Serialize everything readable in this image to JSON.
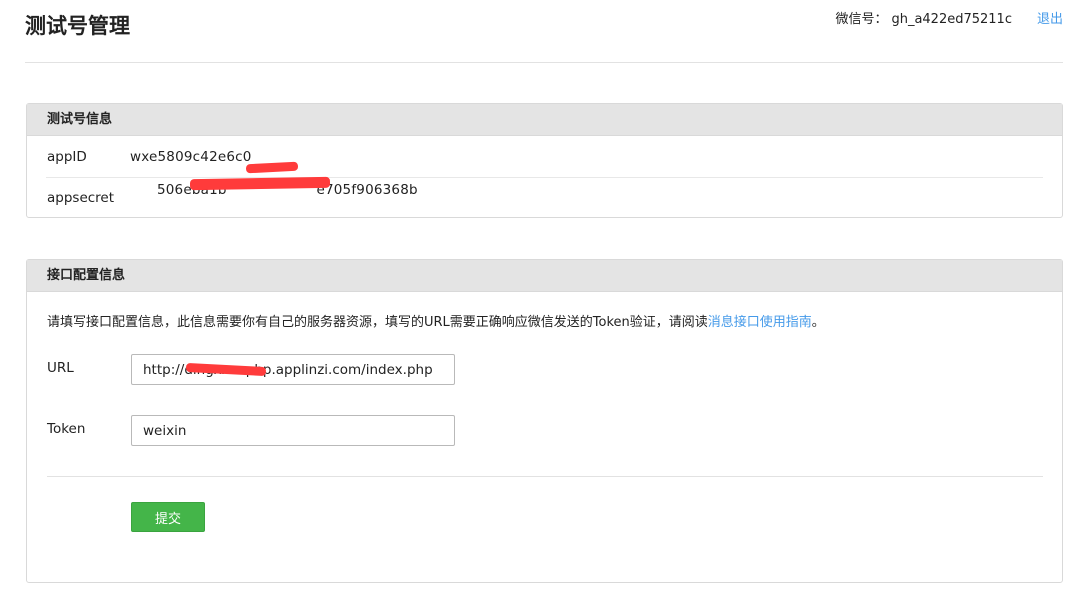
{
  "header": {
    "title": "测试号管理",
    "wechat_id_label": "微信号：",
    "wechat_id": "gh_a422ed75211c",
    "logout_label": "退出"
  },
  "test_account": {
    "heading": "测试号信息",
    "rows": [
      {
        "label": "appID",
        "value": "wxe5809c42e6c0"
      },
      {
        "label": "appsecret",
        "value": "506eba1b                    e705f906368b"
      }
    ]
  },
  "interface_config": {
    "heading": "接口配置信息",
    "description": "请填写接口配置信息，此信息需要你有自己的服务器资源，填写的URL需要正确响应微信发送的Token验证，请阅读",
    "description_link": "消息接口使用指南",
    "description_end": "。",
    "url_label": "URL",
    "url_value": "http://dingxxxxphp.applinzi.com/index.php",
    "token_label": "Token",
    "token_value": "weixin",
    "submit_label": "提交"
  },
  "colors": {
    "accent_link": "#459ae9",
    "submit_green": "#44b549",
    "panel_header": "#e4e4e4",
    "redaction": "#ff3b3b"
  }
}
